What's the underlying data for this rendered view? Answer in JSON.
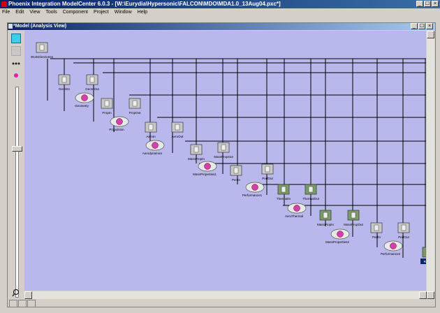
{
  "app": {
    "title": "Phoenix Integration ModelCenter 6.0.3 - [W:\\Eurydia\\Hypersonic\\FALCON\\MDO\\MDA1.0_13Aug04.pxc*]",
    "menu": [
      "File",
      "Edit",
      "View",
      "Tools",
      "Component",
      "Project",
      "Window",
      "Help"
    ],
    "window_buttons": [
      "_",
      "☐",
      "×"
    ]
  },
  "model_window": {
    "title": "*Model (Analysis View)",
    "window_buttons": [
      "_",
      "☐",
      "×"
    ]
  },
  "colors": {
    "canvas_bg": "#b8b8ec",
    "node_box": "#c8c8c8",
    "node_box_green": "#7a9a66",
    "analysis_pink": "#d040b0",
    "link_line": "#000000",
    "result_label_bg": "#0a246a"
  },
  "workflow": {
    "nodes": [
      {
        "label": "WorkDirectories",
        "kind": "box"
      },
      {
        "label": "GeomIn",
        "kind": "box"
      },
      {
        "label": "GeomOut",
        "kind": "box"
      },
      {
        "label": "Geometry",
        "kind": "analysis"
      },
      {
        "label": "PropIn",
        "kind": "box"
      },
      {
        "label": "PropOut",
        "kind": "box"
      },
      {
        "label": "Propulsion",
        "kind": "analysis"
      },
      {
        "label": "AeroIn",
        "kind": "box"
      },
      {
        "label": "AeroOut",
        "kind": "box"
      },
      {
        "label": "Aerodynamics",
        "kind": "analysis"
      },
      {
        "label": "MassPropIn",
        "kind": "box"
      },
      {
        "label": "MassPropOut",
        "kind": "box"
      },
      {
        "label": "MassProperties1",
        "kind": "analysis"
      },
      {
        "label": "PerfIn",
        "kind": "box"
      },
      {
        "label": "PerfOut",
        "kind": "box"
      },
      {
        "label": "Performance1",
        "kind": "analysis"
      },
      {
        "label": "ThermalIn",
        "kind": "box"
      },
      {
        "label": "ThermalOut",
        "kind": "box"
      },
      {
        "label": "AeroThermal",
        "kind": "analysis"
      },
      {
        "label": "MassPropIn",
        "kind": "box"
      },
      {
        "label": "MassPropOut",
        "kind": "box"
      },
      {
        "label": "MassProperties2",
        "kind": "analysis"
      },
      {
        "label": "PerfIn",
        "kind": "box"
      },
      {
        "label": "PerfOut",
        "kind": "box"
      },
      {
        "label": "Performance2",
        "kind": "analysis"
      },
      {
        "label": "Result",
        "kind": "result"
      }
    ]
  },
  "toolbar_icons": [
    "select-arrow-icon",
    "link-icon",
    "dots-icon",
    "pink-marker-icon",
    "zoom-icon"
  ]
}
